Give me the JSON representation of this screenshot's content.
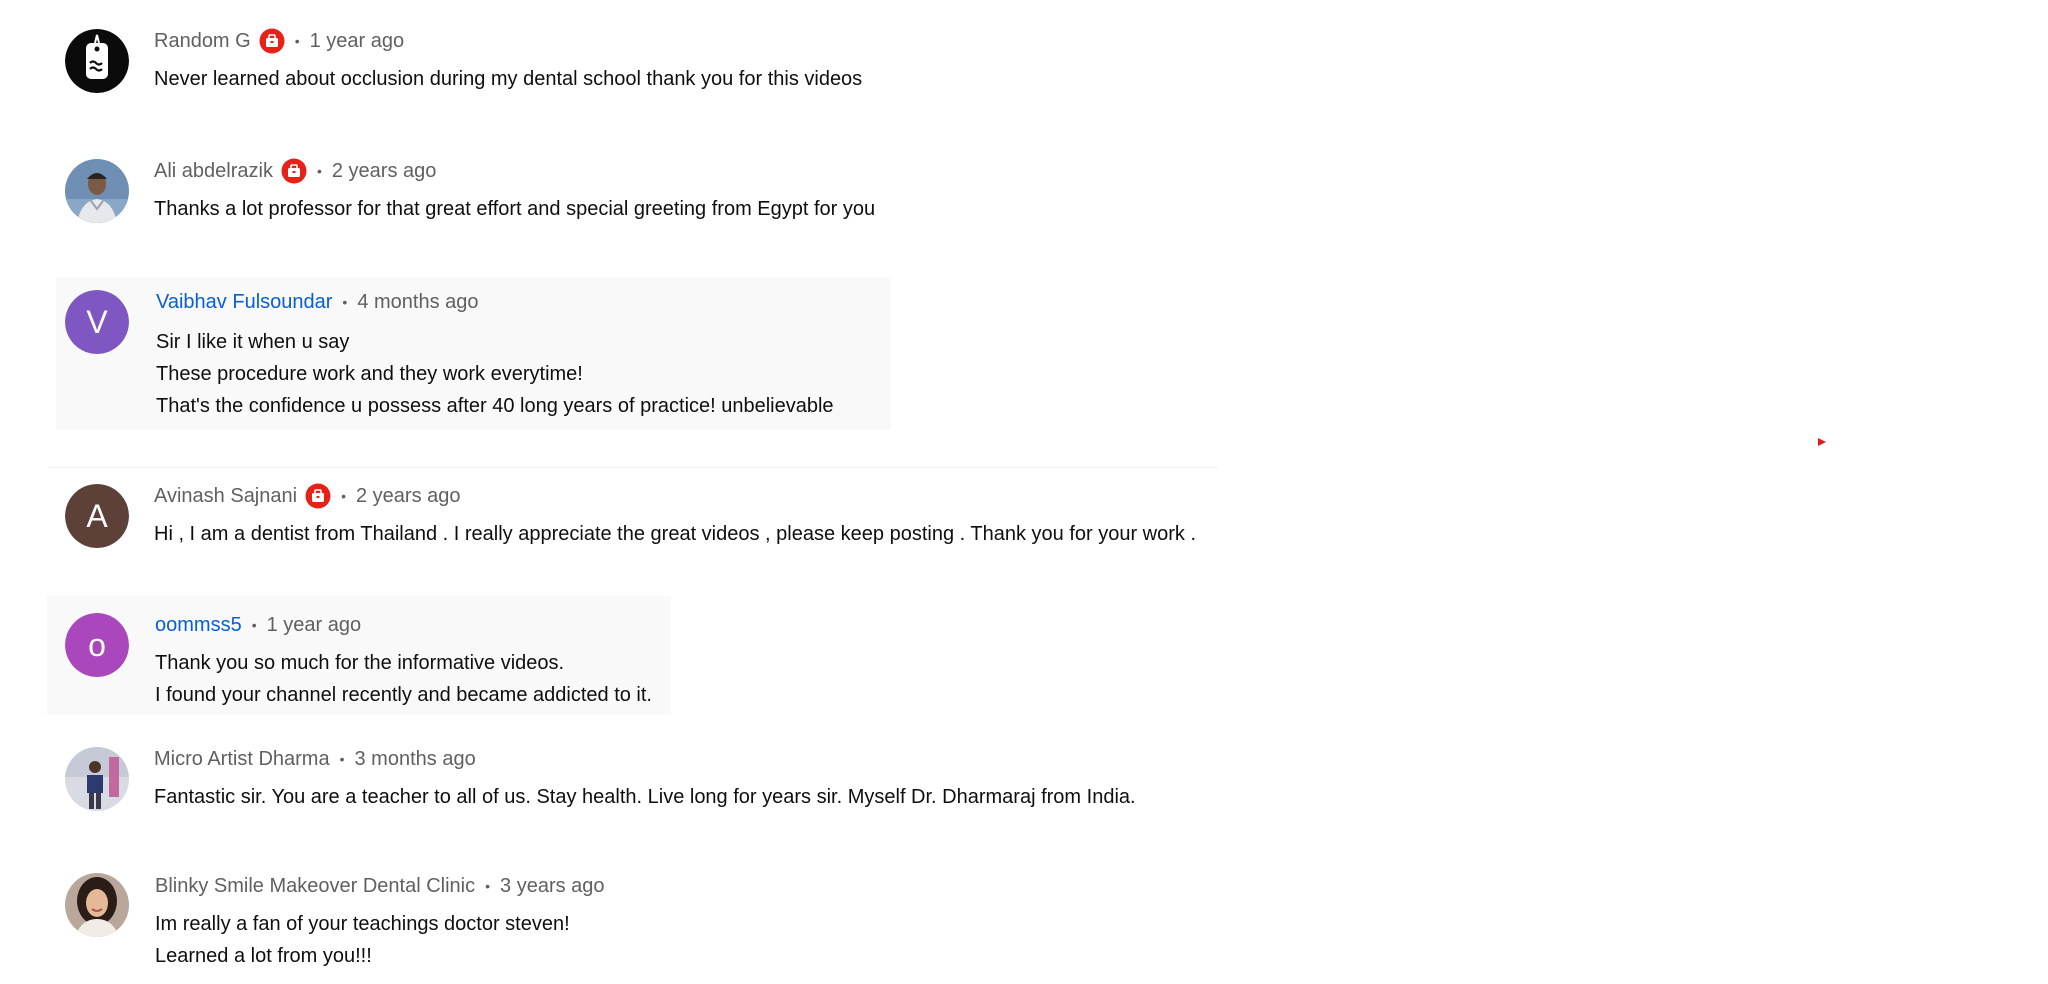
{
  "comments": [
    {
      "author": "Random G",
      "time": "1 year ago",
      "lines": [
        "Never learned about occlusion during my dental school thank you for this videos"
      ]
    },
    {
      "author": "Ali abdelrazik",
      "time": "2 years ago",
      "lines": [
        "Thanks a lot professor for that great effort and special greeting from Egypt for you"
      ]
    },
    {
      "author": "Vaibhav Fulsoundar",
      "avatar_letter": "V",
      "avatar_color": "#7e57c2",
      "time": "4 months ago",
      "lines": [
        "Sir I like it when u say",
        "These procedure work and they work everytime!",
        "That's the confidence u possess after 40 long years of practice! unbelievable"
      ]
    },
    {
      "author": "Avinash Sajnani",
      "avatar_letter": "A",
      "avatar_color": "#5d4037",
      "time": "2 years ago",
      "lines": [
        "Hi , I am a dentist from Thailand . I really appreciate the great videos , please keep posting . Thank you for your work ."
      ]
    },
    {
      "author": "oommss5",
      "avatar_letter": "o",
      "avatar_color": "#ab47bc",
      "time": "1 year ago",
      "lines": [
        "Thank you so much for the informative videos.",
        "I found your channel recently and became addicted to it."
      ]
    },
    {
      "author": "Micro Artist Dharma",
      "time": "3 months ago",
      "lines": [
        "Fantastic sir. You are a teacher to all of us. Stay health. Live long for years sir. Myself Dr. Dharmaraj from India."
      ]
    },
    {
      "author": "Blinky Smile Makeover Dental Clinic",
      "time": "3 years ago",
      "lines": [
        "Im really a fan of your teachings doctor steven!",
        "Learned a lot from you!!!"
      ]
    }
  ],
  "separator": "•",
  "colors": {
    "meta_gray": "#606060",
    "link_blue": "#065fd4",
    "badge_red": "#e62117",
    "highlight_bg": "#f9f9f9"
  }
}
